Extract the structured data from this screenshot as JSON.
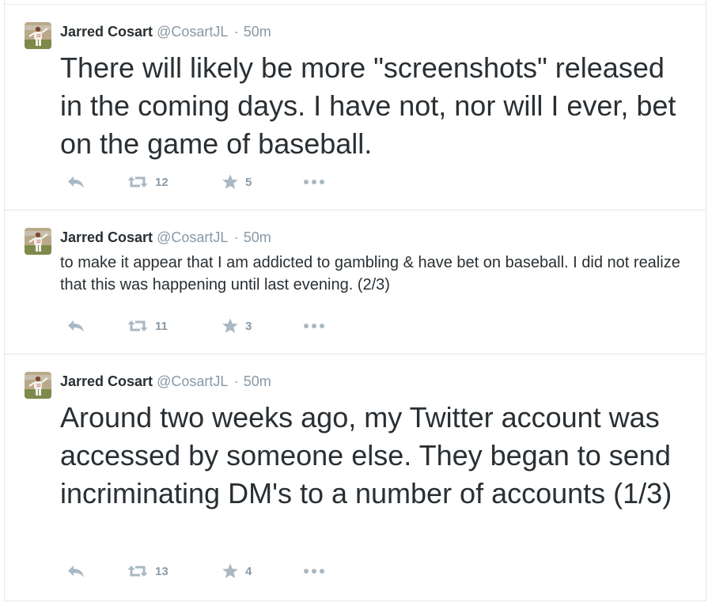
{
  "colors": {
    "text": "#292f33",
    "muted": "#8899a6",
    "icon": "#aab8c2",
    "border": "#e1e8ed"
  },
  "tweets": [
    {
      "name": "Jarred Cosart",
      "handle": "@CosartJL",
      "separator": "·",
      "time": "50m",
      "text": "There will likely be more \"screenshots\" released in the coming days. I have not, nor will I ever, bet on the game of baseball.",
      "retweets": "12",
      "favorites": "5",
      "icons": [
        "reply-icon",
        "retweet-icon",
        "favorite-star-icon",
        "more-options-icon"
      ]
    },
    {
      "name": "Jarred Cosart",
      "handle": "@CosartJL",
      "separator": "·",
      "time": "50m",
      "text": "to make it appear that I am addicted to gambling & have bet on baseball. I did not realize that this was happening until last evening. (2/3)",
      "retweets": "11",
      "favorites": "3",
      "icons": [
        "reply-icon",
        "retweet-icon",
        "favorite-star-icon",
        "more-options-icon"
      ]
    },
    {
      "name": "Jarred Cosart",
      "handle": "@CosartJL",
      "separator": "·",
      "time": "50m",
      "text": "Around two weeks ago, my Twitter account was accessed by someone else. They began to send incriminating DM's to a number of accounts (1/3)",
      "retweets": "13",
      "favorites": "4",
      "icons": [
        "reply-icon",
        "retweet-icon",
        "favorite-star-icon",
        "more-options-icon"
      ]
    }
  ]
}
